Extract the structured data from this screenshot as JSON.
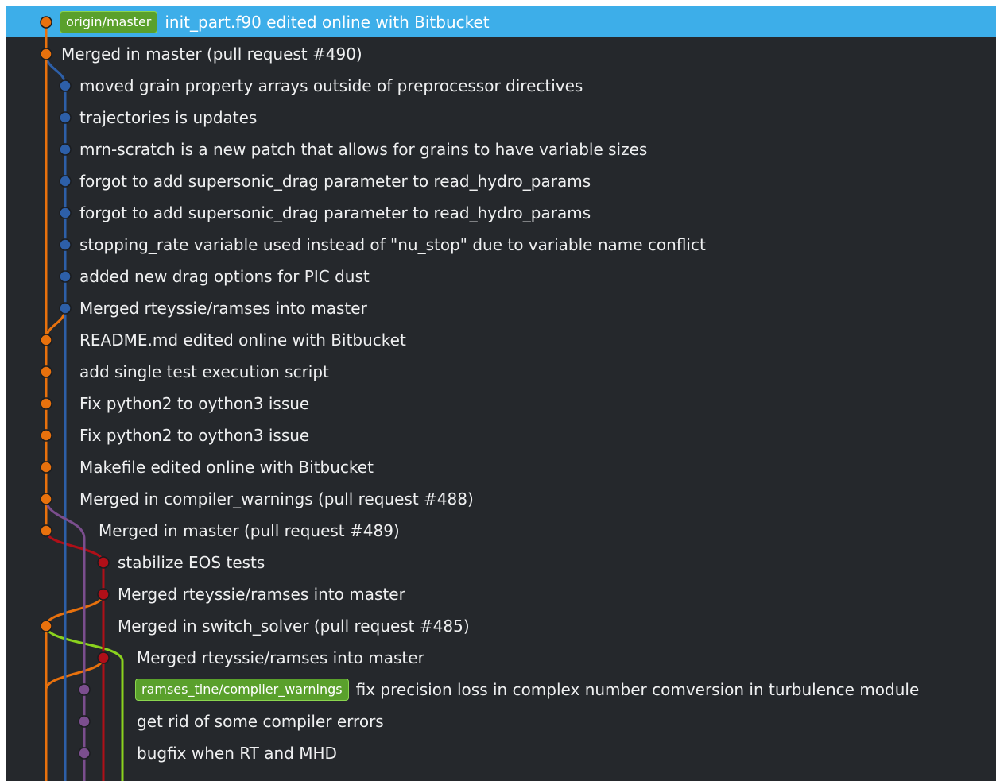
{
  "graph_colors": {
    "orange": "#e8710d",
    "blue": "#2d5fa8",
    "purple": "#7b4e8e",
    "red": "#b00f18",
    "green": "#8ad21e"
  },
  "commits": [
    {
      "message": "init_part.f90 edited online with Bitbucket",
      "ref": "origin/master",
      "selected": true
    },
    {
      "message": "Merged in master (pull request #490)"
    },
    {
      "message": "moved grain property arrays outside of preprocessor directives"
    },
    {
      "message": "trajectories is updates"
    },
    {
      "message": "mrn-scratch is a new patch that allows for grains to have variable sizes"
    },
    {
      "message": "forgot to add supersonic_drag parameter to read_hydro_params"
    },
    {
      "message": "forgot to add supersonic_drag parameter to read_hydro_params"
    },
    {
      "message": "stopping_rate variable used instead of \"nu_stop\" due to variable name conflict"
    },
    {
      "message": "added new drag options for PIC dust"
    },
    {
      "message": "Merged rteyssie/ramses into master"
    },
    {
      "message": "README.md edited online with Bitbucket"
    },
    {
      "message": "add single test execution script"
    },
    {
      "message": "Fix python2 to oython3 issue"
    },
    {
      "message": "Fix python2 to oython3 issue"
    },
    {
      "message": "Makefile edited online with Bitbucket"
    },
    {
      "message": "Merged in compiler_warnings (pull request #488)"
    },
    {
      "message": "Merged in master (pull request #489)"
    },
    {
      "message": "stabilize EOS tests"
    },
    {
      "message": "Merged rteyssie/ramses into master"
    },
    {
      "message": "Merged in switch_solver (pull request #485)"
    },
    {
      "message": "Merged rteyssie/ramses into master"
    },
    {
      "message": "fix precision loss in complex number comversion in turbulence module",
      "ref": "ramses_tine/compiler_warnings"
    },
    {
      "message": "get rid of some compiler errors"
    },
    {
      "message": "bugfix when RT and MHD"
    }
  ]
}
